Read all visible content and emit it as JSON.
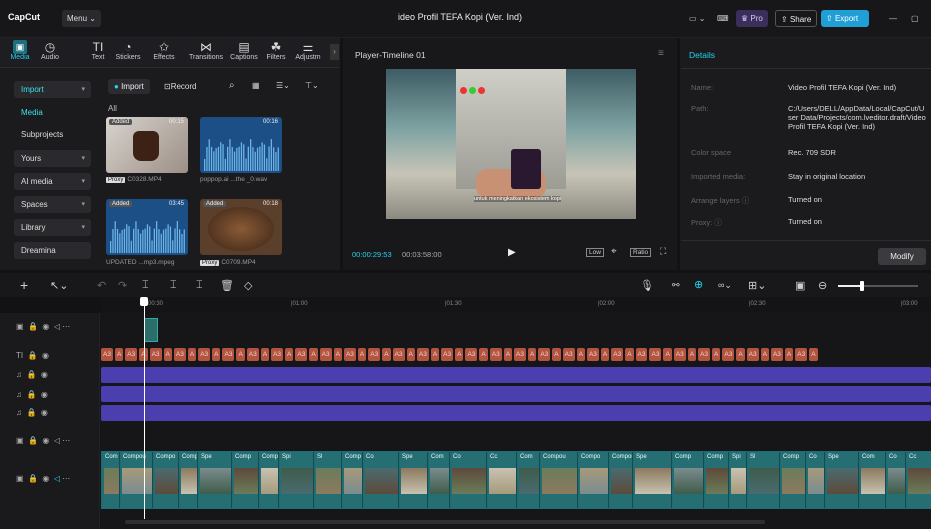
{
  "app": {
    "logo": "CapCut",
    "menu_label": "Menu",
    "title": "ideo Profil TEFA Kopi (Ver. Ind)"
  },
  "titlebar": {
    "pro_label": "Pro",
    "share_label": "Share",
    "export_label": "Export"
  },
  "tabs": [
    {
      "label": "Media",
      "icon": "▣"
    },
    {
      "label": "Audio",
      "icon": "◷"
    },
    {
      "label": "Text",
      "icon": "TI"
    },
    {
      "label": "Stickers",
      "icon": "◔"
    },
    {
      "label": "Effects",
      "icon": "✩"
    },
    {
      "label": "Transitions",
      "icon": "⋈"
    },
    {
      "label": "Captions",
      "icon": "▤"
    },
    {
      "label": "Filters",
      "icon": "☘"
    },
    {
      "label": "Adjustm",
      "icon": "⚌"
    }
  ],
  "sidebar": {
    "items": [
      {
        "label": "Import",
        "chev": "▾"
      },
      {
        "label": "Media",
        "chev": ""
      },
      {
        "label": "Subprojects",
        "chev": ""
      },
      {
        "label": "Yours",
        "chev": "▾"
      },
      {
        "label": "AI media",
        "chev": "▾"
      },
      {
        "label": "Spaces",
        "chev": "▾"
      },
      {
        "label": "Library",
        "chev": "▾"
      },
      {
        "label": "Dreamina",
        "chev": ""
      }
    ]
  },
  "media_toolbar": {
    "import_label": "Import",
    "record_label": "Record",
    "all_label": "All"
  },
  "media_items": [
    {
      "name": "C0328.MP4",
      "proxy": "Proxy",
      "added": "Added",
      "duration": "00:15"
    },
    {
      "name": "poppop.ai ...the _0.wav",
      "proxy": "",
      "added": "",
      "duration": "00:16"
    },
    {
      "name": "UPDATED ...mp3.mpeg",
      "proxy": "",
      "added": "Added",
      "duration": "03:45"
    },
    {
      "name": "C0709.MP4",
      "proxy": "Proxy",
      "added": "Added",
      "duration": "00:18"
    }
  ],
  "player": {
    "title": "Player-Timeline 01",
    "current_time": "00:00:29:53",
    "total_time": "00:03:58:00",
    "subtitle": "untuk meningkatkan ekosistem kopi",
    "low_label": "Low",
    "ratio_label": "Ratio"
  },
  "details": {
    "title": "Details",
    "rows": [
      {
        "label": "Name:",
        "value": "Video Profil TEFA Kopi (Ver. Ind)"
      },
      {
        "label": "Path:",
        "value": "C:/Users/DELL/AppData/Local/CapCut/User Data/Projects/com.lveditor.draft/Video Profil TEFA Kopi (Ver. Ind)"
      },
      {
        "label": "Color space",
        "value": "Rec. 709 SDR"
      },
      {
        "label": "Imported media:",
        "value": "Stay in original location"
      },
      {
        "label": "Arrange layers ⓘ",
        "value": "Turned on"
      },
      {
        "label": "Proxy: ⓘ",
        "value": "Turned on"
      }
    ],
    "modify_label": "Modify"
  },
  "ruler": {
    "ticks": [
      "00:30",
      "|01:00",
      "|01:30",
      "|02:00",
      "|02:30",
      "|03:00"
    ]
  },
  "caption_clip": "A",
  "caption_clip_short": "A3",
  "video_clips": [
    "Com",
    "Compou",
    "Compo",
    "Compound c",
    "Spe",
    "Comp",
    "Comp",
    "Spi",
    "Sl",
    "Comp",
    "Co",
    "Spe",
    "Com",
    "Co",
    "Cc"
  ],
  "colors": {
    "accent": "#22d3ee",
    "caption": "#b2543f",
    "audio": "#4b3fb0",
    "video": "#1f6d73",
    "export": "#1f9fd6"
  }
}
